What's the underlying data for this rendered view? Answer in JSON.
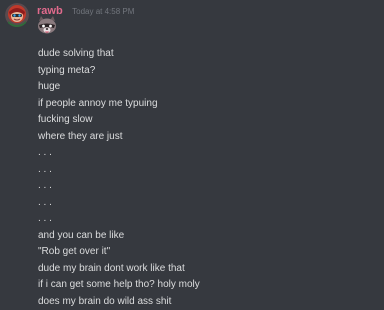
{
  "message": {
    "username": "rawb",
    "timestamp": "Today at 4:58 PM",
    "colors": {
      "username": "#e06a8c",
      "timestamp": "#72767d",
      "text": "#dcddde",
      "background": "#36393f"
    },
    "avatar_icon": "user-avatar-icon",
    "sticker_icon": "raccoon-emoji-icon",
    "lines": [
      "dude solving that",
      "typing meta?",
      "huge",
      "if people annoy me typuing",
      "fucking slow",
      "where they are just",
      ". . .",
      ". . .",
      ". . .",
      ". . .",
      ". . .",
      "and you can be like",
      "\"Rob get over it\"",
      "dude my brain dont work like that",
      "if i can get some help tho? holy moly",
      "does my brain do wild ass shit"
    ]
  }
}
